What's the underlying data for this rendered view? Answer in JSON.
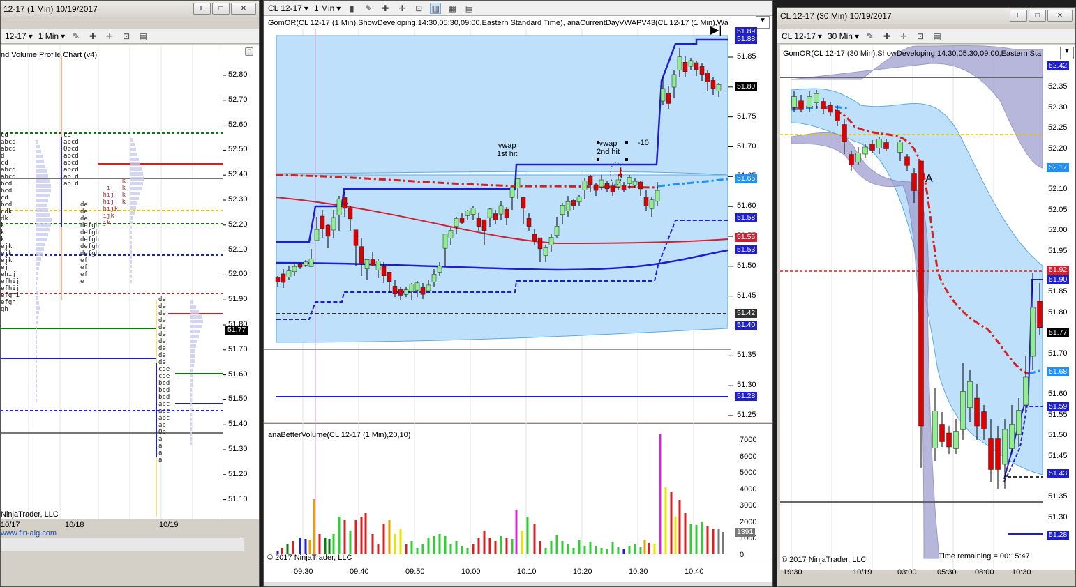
{
  "left": {
    "title": "12-17 (1 Min)  10/19/2017",
    "instrument": "12-17",
    "interval": "1 Min",
    "indicator_label": "nd Volume Profile Chart (v4)",
    "price_labels": [
      "52.80",
      "52.70",
      "52.60",
      "52.50",
      "52.40",
      "52.30",
      "52.20",
      "52.10",
      "52.00",
      "51.90",
      "51.80",
      "51.70",
      "51.60",
      "51.50",
      "51.40",
      "51.30",
      "51.20",
      "51.10"
    ],
    "current_price": "51.77",
    "x_labels": [
      "10/17",
      "10/18",
      "10/19"
    ],
    "copyright": "NinjaTrader, LLC",
    "site": "www.fin-alg.com",
    "f_button": "F",
    "tpo_col1": "cd\nabcd\nabcd\nd\ncd\nabcd\nabcd\nbcd\nbcd\ncd\nbcd\ncdk\ndk\nk\nk\nk\nejk\nejk\nejk\nej\nehij\nefhij\nefhij\nefghi\nefgh\ngh",
    "tpo_col2": "cd\nabcd\nObcd\nabcd\nabcd\nabcd\nab d\nab d",
    "tpo_col3": "de\nde\nde\ndefgh\ndefgh\ndefgh\ndefgh\ndefgh\nef\nef\nef\ne",
    "tpo_col3b": "           k\n       i   k\n      hij  k\n      hij  k\n      hijk\n      ijk\n      jk",
    "tpo_col4": "de\nde\nde\nde\nde\nde\nde\nde\nde\nde\ncde\ncde\nbcd\nbcd\nbcd\nabc\nabc\nabc\nab\nOb\na\na\na\na"
  },
  "middle": {
    "instrument": "CL 12-17",
    "interval": "1 Min",
    "indicator_label": "GomOR(CL 12-17 (1 Min),ShowDeveloping,14:30,05:30,09:00,Eastern Standard Time), anaCurrentDayVWAPV43(CL 12-17 (1 Min),Wa",
    "price_labels": [
      "51.85",
      "51.80",
      "51.75",
      "51.70",
      "51.65",
      "51.60",
      "51.55",
      "51.50",
      "51.45",
      "51.40",
      "51.35",
      "51.30",
      "51.25"
    ],
    "price_boxes": [
      {
        "text": "51.89",
        "color": "#1f1fcf"
      },
      {
        "text": "51.88",
        "color": "#1f1fcf"
      },
      {
        "text": "51.80",
        "color": "#000000"
      },
      {
        "text": "51.65",
        "color": "#1e90ff"
      },
      {
        "text": "51.58",
        "color": "#1f1fcf"
      },
      {
        "text": "51.55",
        "color": "#cc2233"
      },
      {
        "text": "51.53",
        "color": "#1f1fcf"
      },
      {
        "text": "51.42",
        "color": "#333333"
      },
      {
        "text": "51.40",
        "color": "#1f1fcf"
      },
      {
        "text": "51.28",
        "color": "#1f1fcf"
      }
    ],
    "annotations": {
      "vwap1": "vwap\n1st hit",
      "vwap2": "vwap\n2nd hit",
      "minus10": "-10"
    },
    "volume_label": "anaBetterVolume(CL 12-17 (1 Min),20,10)",
    "volume_ticks": [
      "7000",
      "6000",
      "5000",
      "4000",
      "3000",
      "2000",
      "1000",
      "0"
    ],
    "volume_current": "1391",
    "copyright": "© 2017 NinjaTrader, LLC",
    "x_labels": [
      "09:30",
      "09:40",
      "09:50",
      "10:00",
      "10:10",
      "10:20",
      "10:30",
      "10:40"
    ]
  },
  "right": {
    "title": "CL 12-17 (30 Min)  10/19/2017",
    "instrument": "CL 12-17",
    "interval": "30 Min",
    "indicator_label": "GomOR(CL 12-17 (30 Min),ShowDeveloping,14:30,05:30,09:00,Eastern Sta",
    "price_labels": [
      "52.4",
      "52.35",
      "52.30",
      "52.25",
      "52.20",
      "52.15",
      "52.10",
      "52.05",
      "52.00",
      "51.95",
      "51.90",
      "51.85",
      "51.80",
      "51.75",
      "51.70",
      "51.65",
      "51.60",
      "51.55",
      "51.50",
      "51.45",
      "51.40",
      "51.35",
      "51.30",
      "51.25"
    ],
    "price_boxes": [
      {
        "text": "52.42",
        "color": "#1f1fcf"
      },
      {
        "text": "52.17",
        "color": "#1e90ff"
      },
      {
        "text": "51.92",
        "color": "#cc2233"
      },
      {
        "text": "51.90",
        "color": "#1f1fcf"
      },
      {
        "text": "51.77",
        "color": "#000000"
      },
      {
        "text": "51.68",
        "color": "#1e90ff"
      },
      {
        "text": "51.59",
        "color": "#1f1fcf"
      },
      {
        "text": "51.43",
        "color": "#1f1fcf"
      },
      {
        "text": "51.28",
        "color": "#1f1fcf"
      }
    ],
    "annotation_a": "A",
    "copyright": "© 2017 NinjaTrader, LLC",
    "time_remaining": "Time remaining = 00:15:47",
    "x_labels": [
      "19:30",
      "10/19",
      "03:00",
      "05:30",
      "08:00",
      "10:30"
    ]
  },
  "colors": {
    "band_fill": "#bfe0fb",
    "cloud_fill": "#a0a0d0",
    "vwap_red": "#d42020",
    "or_blue": "#1f1fcf",
    "up_candle": "#90ee90",
    "down_candle": "#e00000"
  },
  "window_buttons": {
    "minimize": "L",
    "maximize": "□",
    "close": "✕"
  }
}
